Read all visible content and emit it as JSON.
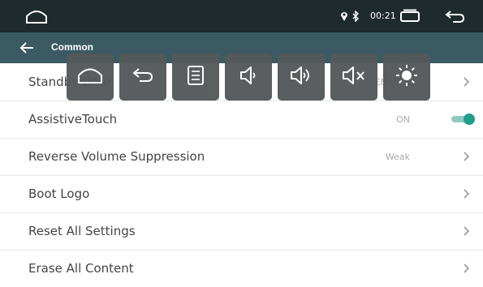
{
  "statusbar": {
    "home_icon": "home-outline-icon",
    "location_icon": "location-pin-icon",
    "bluetooth_icon": "bluetooth-icon",
    "time": "00:21",
    "recent_apps_icon": "recent-apps-icon",
    "back_icon": "back-arrow-icon"
  },
  "header": {
    "back_icon": "left-arrow-icon",
    "title": "Common",
    "bg_color": "#3b5a63"
  },
  "settings": {
    "standby": {
      "label": "Standby time",
      "value": "ENABLE"
    },
    "assistive_touch": {
      "label": "AssistiveTouch",
      "value": "ON",
      "toggle_on": true
    },
    "reverse_volume": {
      "label": "Reverse Volume Suppression",
      "value": "Weak"
    },
    "boot_logo": {
      "label": "Boot Logo"
    },
    "reset_all": {
      "label": "Reset All Settings"
    },
    "erase_all": {
      "label": "Erase All Content"
    }
  },
  "quick_bar": {
    "buttons": [
      "home-icon",
      "back-icon",
      "menu-list-icon",
      "volume-down-icon",
      "volume-up-icon",
      "mute-icon",
      "brightness-icon"
    ]
  },
  "colors": {
    "accent": "#1f9e8c",
    "statusbar": "#1f2a2c",
    "quickbar_button": "#54585a"
  }
}
